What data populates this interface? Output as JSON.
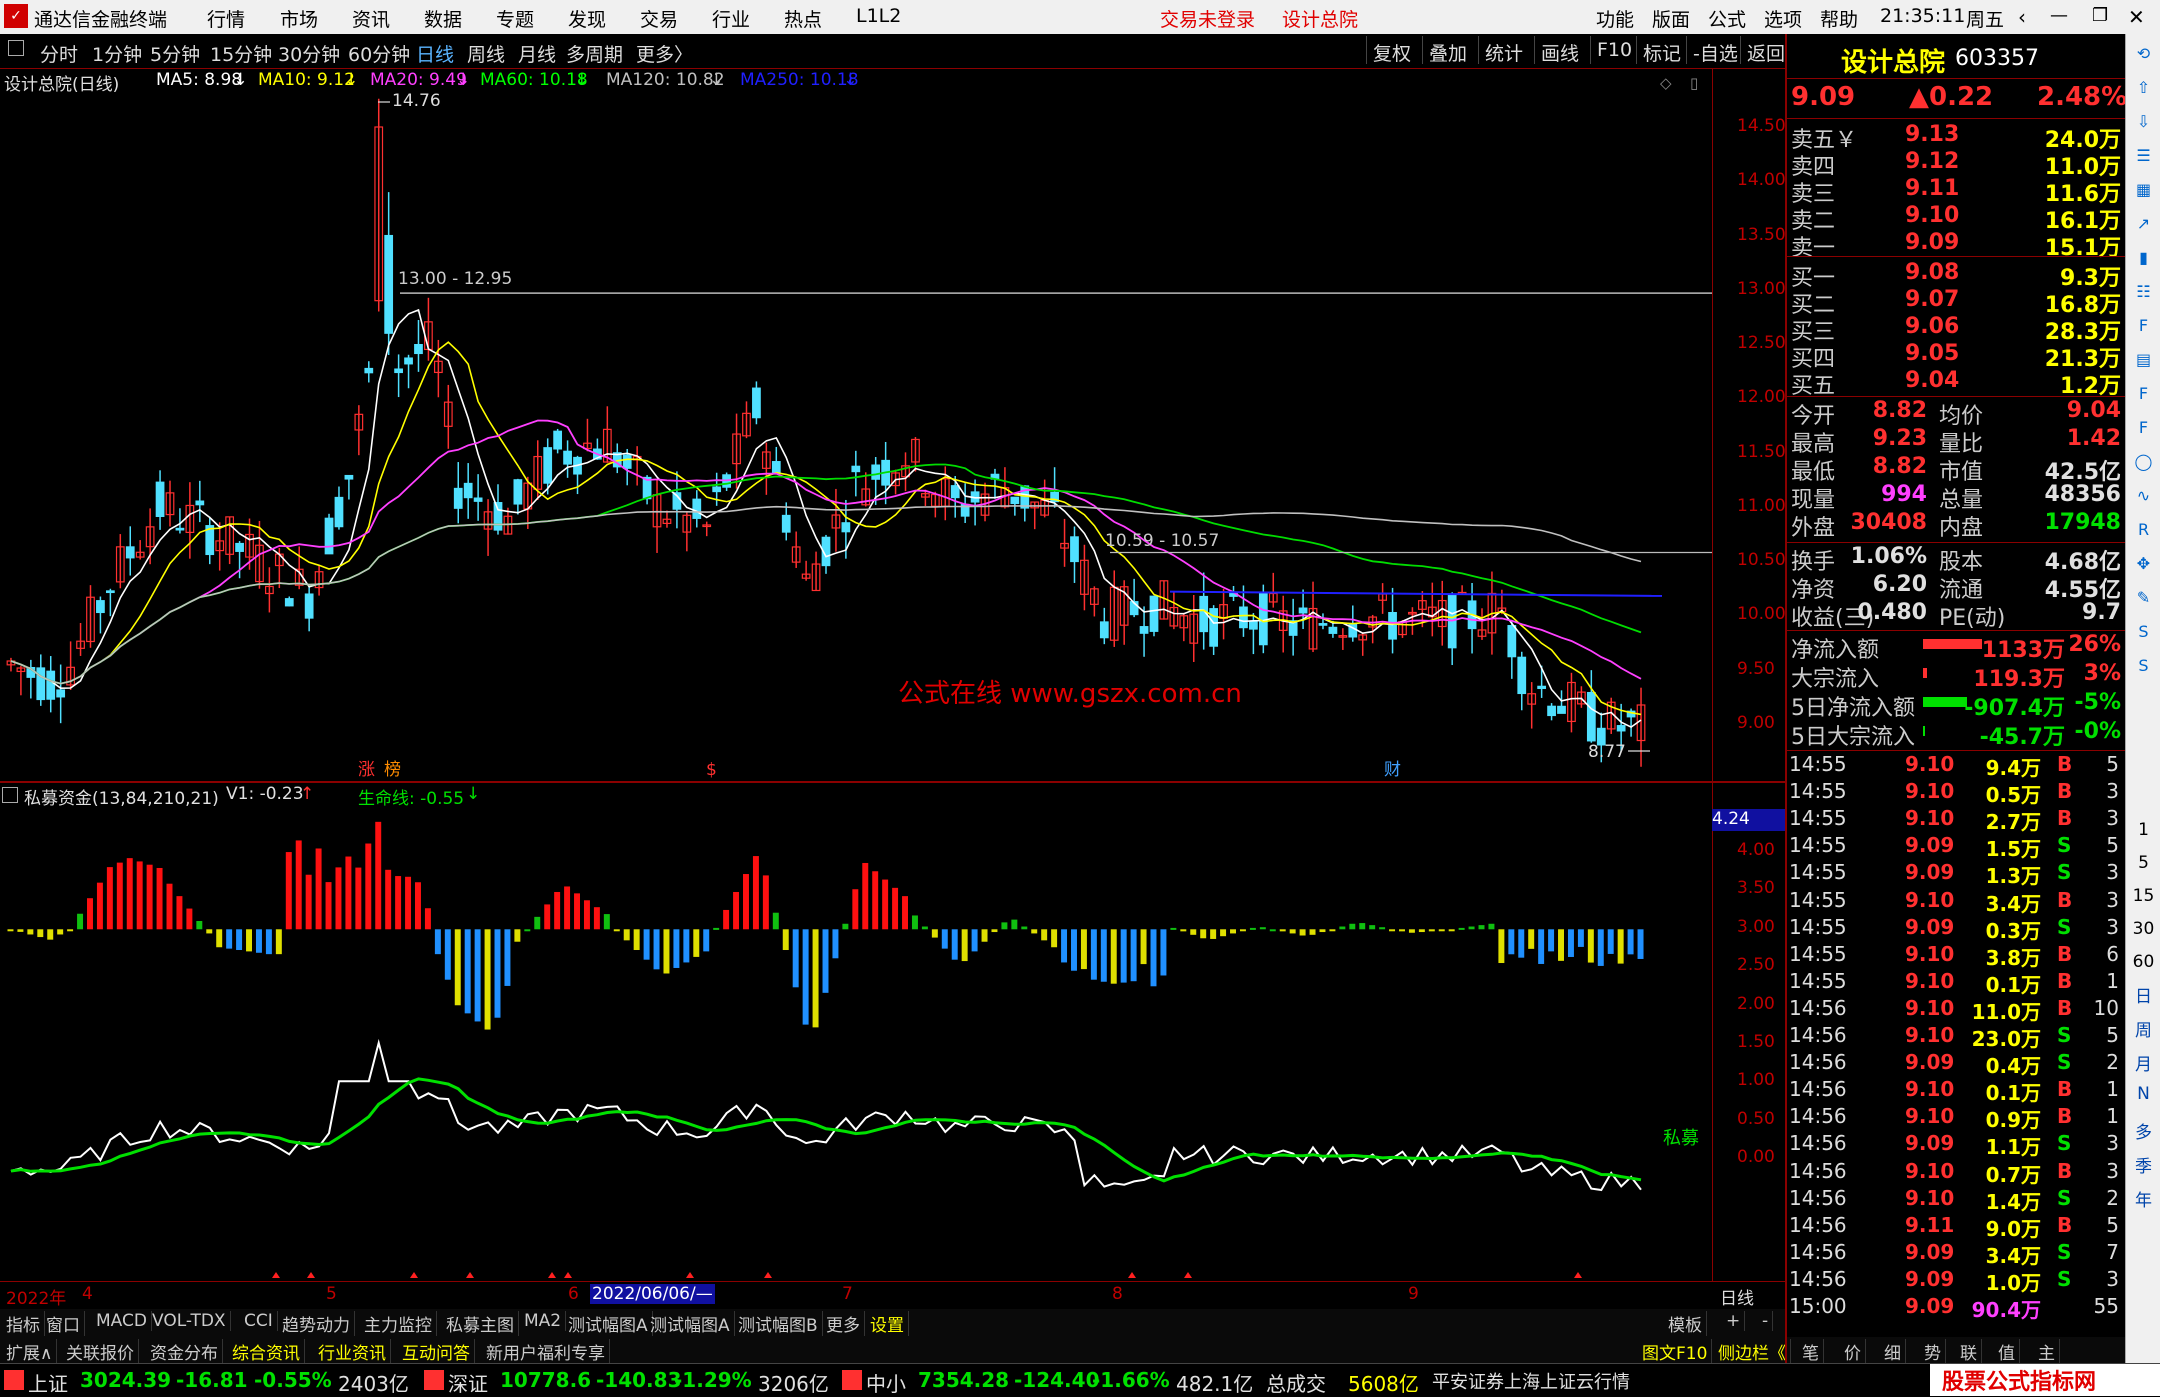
{
  "titlebar": {
    "app_name": "通达信金融终端",
    "menus": [
      "行情",
      "市场",
      "资讯",
      "数据",
      "专题",
      "发现",
      "交易",
      "行业",
      "热点",
      "L1L2"
    ],
    "status_trade": "交易未登录",
    "status_stock": "设计总院",
    "right_menus": [
      "功能",
      "版面",
      "公式",
      "选项",
      "帮助"
    ],
    "clock": "21:35:11",
    "weekday": "周五"
  },
  "periodbar": {
    "periods": [
      "分时",
      "1分钟",
      "5分钟",
      "15分钟",
      "30分钟",
      "60分钟",
      "日线",
      "周线",
      "月线",
      "多周期",
      "更多〉"
    ],
    "selected": "日线",
    "buttons": [
      "复权",
      "叠加",
      "统计",
      "画线",
      "F10",
      "标记",
      "-自选",
      "返回"
    ]
  },
  "mainchart": {
    "stock_title": "设计总院(日线)",
    "ma": [
      {
        "label": "MA5: 8.98",
        "color": "#ffffff"
      },
      {
        "label": "MA10: 9.12",
        "color": "#ffff00"
      },
      {
        "label": "MA20: 9.49",
        "color": "#ff40ff"
      },
      {
        "label": "MA60: 10.18",
        "color": "#00ff00"
      },
      {
        "label": "MA120: 10.82",
        "color": "#c0c0c0"
      },
      {
        "label": "MA250: 10.18",
        "color": "#2020ff"
      }
    ],
    "high_label": "14.76",
    "low_label": "8.77",
    "range_label_1": "13.00 - 12.95",
    "range_label_2": "10.59 - 10.57",
    "watermark": "公式在线 www.gszx.com.cn",
    "price_ticks": [
      "14.50",
      "14.00",
      "13.50",
      "13.00",
      "12.50",
      "12.00",
      "11.50",
      "11.00",
      "10.50",
      "10.00",
      "9.50",
      "9.00"
    ],
    "event_marks": [
      "涨",
      "榜",
      "$",
      "财"
    ]
  },
  "subchart": {
    "indicator_title": "私募资金(13,84,210,21)",
    "v1_label": "V1: -0.23",
    "life_label": "生命线: -0.55",
    "current_value": "4.24",
    "series_label": "私募",
    "ticks": [
      "4.00",
      "3.50",
      "3.00",
      "2.50",
      "2.00",
      "1.50",
      "1.00",
      "0.50",
      "0.00"
    ]
  },
  "dateaxis": {
    "labels": [
      "2022年",
      "4",
      "5",
      "6",
      "2022/06/06/—",
      "7",
      "8",
      "9"
    ],
    "right_label": "日线"
  },
  "tabs1": [
    "指标",
    "窗口",
    "MACD",
    "VOL-TDX",
    "CCI",
    "趋势动力",
    "主力监控",
    "私募主图",
    "MA2",
    "测试幅图A",
    "测试幅图A",
    "测试幅图B",
    "更多",
    "设置",
    "模板",
    "+",
    "-"
  ],
  "tabs2": [
    "扩展∧",
    "关联报价",
    "资金分布",
    "综合资讯",
    "行业资讯",
    "互动问答",
    "新用户福利专享"
  ],
  "tabs2_right": [
    "图文F10",
    "侧边栏《",
    "笔",
    "价",
    "细",
    "势",
    "联",
    "值",
    "主"
  ],
  "statusbar": {
    "items": [
      {
        "name": "上证",
        "value": "3024.39",
        "chg": "-16.81",
        "pct": "-0.55%",
        "amt": "2403亿"
      },
      {
        "name": "深证",
        "value": "10778.6",
        "chg": "-140.83",
        "pct": "-1.29%",
        "amt": "3206亿"
      },
      {
        "name": "中小",
        "value": "7354.28",
        "chg": "-124.40",
        "pct": "-1.66%",
        "amt": "482.1亿"
      }
    ],
    "total_label": "总成交",
    "total_value": "5608亿",
    "server": "平安证券上海上证云行情",
    "logo_text": "股票公式指标网",
    "logo_url": "www.gszx.com.cn"
  },
  "quote": {
    "name": "设计总院",
    "code": "603357",
    "price": "9.09",
    "change": "▲0.22",
    "pct": "2.48%",
    "asks": [
      {
        "label": "卖五￥",
        "price": "9.13",
        "vol": "24.0万"
      },
      {
        "label": "卖四",
        "price": "9.12",
        "vol": "11.0万"
      },
      {
        "label": "卖三",
        "price": "9.11",
        "vol": "11.6万"
      },
      {
        "label": "卖二",
        "price": "9.10",
        "vol": "16.1万"
      },
      {
        "label": "卖一",
        "price": "9.09",
        "vol": "15.1万"
      }
    ],
    "bids": [
      {
        "label": "买一",
        "price": "9.08",
        "vol": "9.3万"
      },
      {
        "label": "买二",
        "price": "9.07",
        "vol": "16.8万"
      },
      {
        "label": "买三",
        "price": "9.06",
        "vol": "28.3万"
      },
      {
        "label": "买四",
        "price": "9.05",
        "vol": "21.3万"
      },
      {
        "label": "买五",
        "price": "9.04",
        "vol": "1.2万"
      }
    ],
    "stats": [
      {
        "l1": "今开",
        "v1": "8.82",
        "c1": "red",
        "l2": "均价",
        "v2": "9.04",
        "c2": "red"
      },
      {
        "l1": "最高",
        "v1": "9.23",
        "c1": "red",
        "l2": "量比",
        "v2": "1.42",
        "c2": "red"
      },
      {
        "l1": "最低",
        "v1": "8.82",
        "c1": "red",
        "l2": "市值",
        "v2": "42.5亿",
        "c2": "wht"
      },
      {
        "l1": "现量",
        "v1": "994",
        "c1": "mag",
        "l2": "总量",
        "v2": "48356",
        "c2": "wht"
      },
      {
        "l1": "外盘",
        "v1": "30408",
        "c1": "red",
        "l2": "内盘",
        "v2": "17948",
        "c2": "grn"
      }
    ],
    "stats2": [
      {
        "l1": "换手",
        "v1": "1.06%",
        "l2": "股本",
        "v2": "4.68亿"
      },
      {
        "l1": "净资",
        "v1": "6.20",
        "l2": "流通",
        "v2": "4.55亿"
      },
      {
        "l1": "收益(三)",
        "v1": "0.480",
        "l2": "PE(动)",
        "v2": "9.7"
      }
    ],
    "flows": [
      {
        "label": "净流入额",
        "value": "1133万",
        "pct": "26%",
        "color": "red",
        "bar": 0.8
      },
      {
        "label": "大宗流入",
        "value": "119.3万",
        "pct": "3%",
        "color": "red",
        "bar": 0.05
      },
      {
        "label": "5日净流入额",
        "value": "-907.4万",
        "pct": "-5%",
        "color": "grn",
        "bar": 0.6
      },
      {
        "label": "5日大宗流入",
        "value": "-45.7万",
        "pct": "-0%",
        "color": "grn",
        "bar": 0.02
      }
    ],
    "ticks": [
      {
        "t": "14:55",
        "p": "9.10",
        "v": "9.4万",
        "d": "B",
        "n": "5"
      },
      {
        "t": "14:55",
        "p": "9.10",
        "v": "0.5万",
        "d": "B",
        "n": "3"
      },
      {
        "t": "14:55",
        "p": "9.10",
        "v": "2.7万",
        "d": "B",
        "n": "3"
      },
      {
        "t": "14:55",
        "p": "9.09",
        "v": "1.5万",
        "d": "S",
        "n": "5"
      },
      {
        "t": "14:55",
        "p": "9.09",
        "v": "1.3万",
        "d": "S",
        "n": "3"
      },
      {
        "t": "14:55",
        "p": "9.10",
        "v": "3.4万",
        "d": "B",
        "n": "3"
      },
      {
        "t": "14:55",
        "p": "9.09",
        "v": "0.3万",
        "d": "S",
        "n": "3"
      },
      {
        "t": "14:55",
        "p": "9.10",
        "v": "3.8万",
        "d": "B",
        "n": "6"
      },
      {
        "t": "14:55",
        "p": "9.10",
        "v": "0.1万",
        "d": "B",
        "n": "1"
      },
      {
        "t": "14:56",
        "p": "9.10",
        "v": "11.0万",
        "d": "B",
        "n": "10"
      },
      {
        "t": "14:56",
        "p": "9.10",
        "v": "23.0万",
        "d": "S",
        "n": "5"
      },
      {
        "t": "14:56",
        "p": "9.09",
        "v": "0.4万",
        "d": "S",
        "n": "2"
      },
      {
        "t": "14:56",
        "p": "9.10",
        "v": "0.1万",
        "d": "B",
        "n": "1"
      },
      {
        "t": "14:56",
        "p": "9.10",
        "v": "0.9万",
        "d": "B",
        "n": "1"
      },
      {
        "t": "14:56",
        "p": "9.09",
        "v": "1.1万",
        "d": "S",
        "n": "3"
      },
      {
        "t": "14:56",
        "p": "9.10",
        "v": "0.7万",
        "d": "B",
        "n": "3"
      },
      {
        "t": "14:56",
        "p": "9.10",
        "v": "1.4万",
        "d": "S",
        "n": "2"
      },
      {
        "t": "14:56",
        "p": "9.11",
        "v": "9.0万",
        "d": "B",
        "n": "5"
      },
      {
        "t": "14:56",
        "p": "9.09",
        "v": "3.4万",
        "d": "S",
        "n": "7"
      },
      {
        "t": "14:56",
        "p": "9.09",
        "v": "1.0万",
        "d": "S",
        "n": "3"
      },
      {
        "t": "15:00",
        "p": "9.09",
        "v": "90.4万",
        "d": "",
        "n": "55"
      }
    ]
  },
  "sidebar": {
    "icons": [
      "back-icon",
      "up-icon",
      "down-icon",
      "list-icon",
      "grid-icon",
      "chart-icon",
      "bars-icon",
      "table-icon",
      "fin-icon",
      "doc-icon",
      "f10-icon",
      "f2-icon",
      "circle-icon",
      "wave-icon",
      "rsi-icon",
      "move-icon",
      "pen-icon",
      "fs-icon",
      "fs2-icon"
    ],
    "texts": [
      "1",
      "5",
      "15",
      "30",
      "60",
      "日",
      "周",
      "月",
      "N",
      "多",
      "季",
      "年"
    ]
  }
}
